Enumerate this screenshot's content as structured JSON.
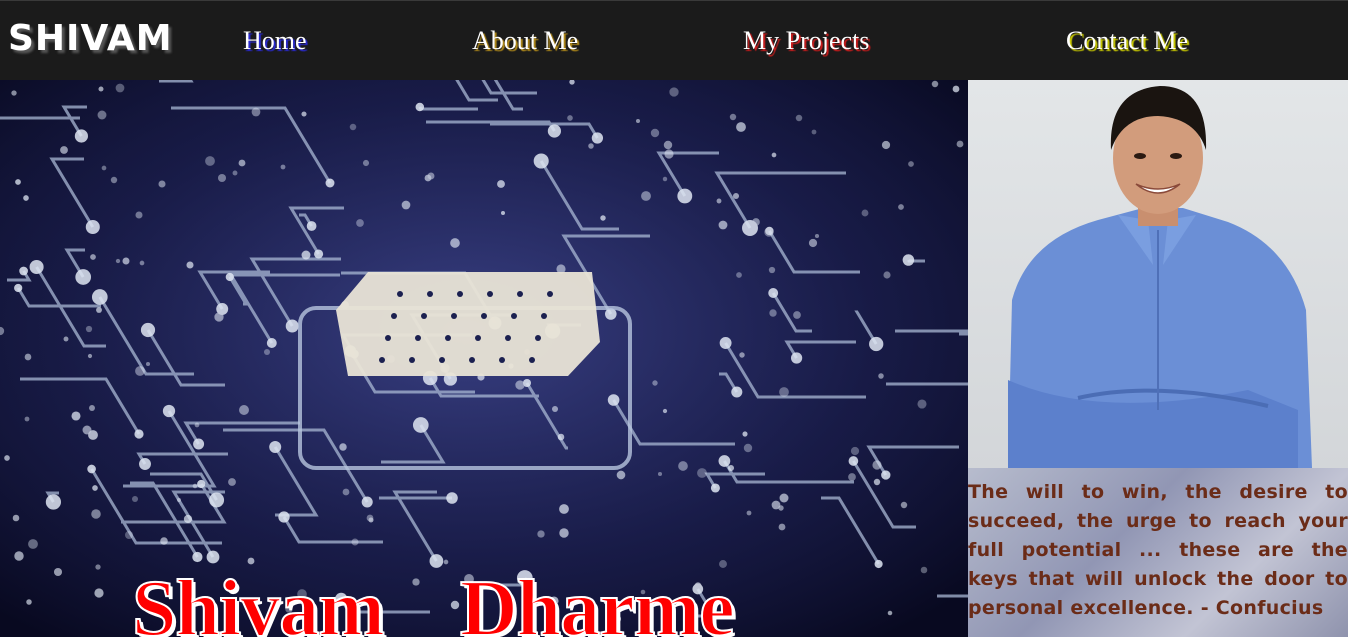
{
  "nav": {
    "brand": "SHIVAM",
    "links": [
      {
        "label": "Home"
      },
      {
        "label": "About Me"
      },
      {
        "label": "My Projects"
      },
      {
        "label": "Contact Me"
      }
    ]
  },
  "hero": {
    "name": "Shivam    Dharme",
    "background_icon": "circuit-board-image"
  },
  "profile": {
    "photo_icon": "profile-photo"
  },
  "quote": {
    "text": "The will to win, the desire to succeed, the urge to reach your full potential ... these are the keys that will unlock the door to personal excellence. - Confucius"
  },
  "colors": {
    "navbar": "#1b1b1b",
    "name_red": "#ff0000",
    "quote_brown": "#6b2c18",
    "shirt_blue": "#6b8fd6"
  }
}
